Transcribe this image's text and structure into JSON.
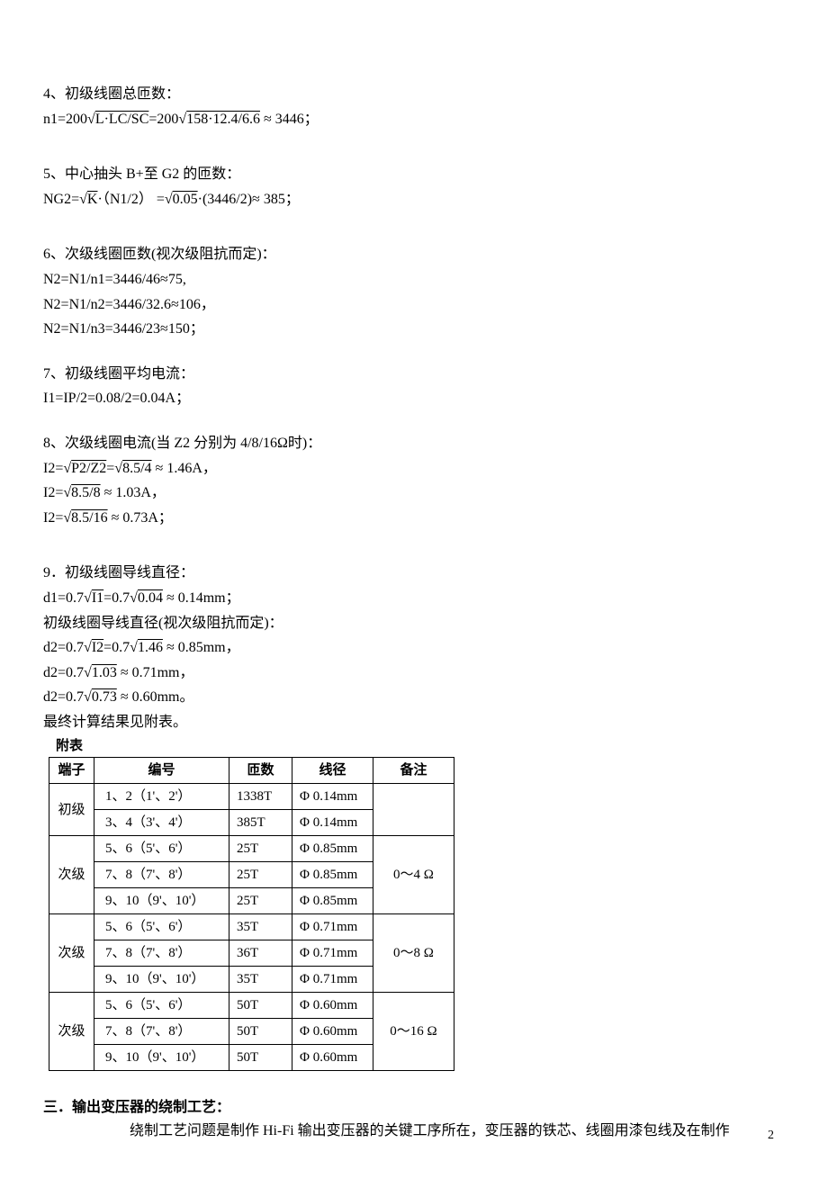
{
  "s4": {
    "heading": "4、初级线圈总匝数：",
    "formula_prefix": "n1=200√",
    "formula_sqrt1": "L·LC/SC",
    "formula_mid": "=200√",
    "formula_sqrt2": "158·12.4/6.6",
    "formula_suffix": " ≈ 3446；"
  },
  "s5": {
    "heading": "5、中心抽头 B+至 G2 的匝数：",
    "formula_prefix": "NG2=√",
    "formula_sqrt1": "K",
    "formula_mid1": "·（N1/2） =√",
    "formula_sqrt2": "0.05",
    "formula_suffix": "·(3446/2)≈ 385；"
  },
  "s6": {
    "heading": "6、次级线圈匝数(视次级阻抗而定)：",
    "line1": "N2=N1/n1=3446/46≈75,",
    "line2": "N2=N1/n2=3446/32.6≈106，",
    "line3": "N2=N1/n3=3446/23≈150；"
  },
  "s7": {
    "heading": "7、初级线圈平均电流：",
    "line1": "I1=IP/2=0.08/2=0.04A；"
  },
  "s8": {
    "heading": "8、次级线圈电流(当 Z2 分别为 4/8/16Ω时)：",
    "f1_prefix": "I2=√",
    "f1_sqrt1": "P2/Z2",
    "f1_mid": "=√",
    "f1_sqrt2": "8.5/4",
    "f1_suffix": " ≈ 1.46A，",
    "f2_prefix": "I2=√",
    "f2_sqrt": "8.5/8",
    "f2_suffix": " ≈ 1.03A，",
    "f3_prefix": "I2=√",
    "f3_sqrt": "8.5/16",
    "f3_suffix": " ≈ 0.73A；"
  },
  "s9": {
    "heading": "9．初级线圈导线直径：",
    "f1_prefix": "d1=0.7√",
    "f1_sqrt1": "I1",
    "f1_mid": "=0.7√",
    "f1_sqrt2": "0.04",
    "f1_suffix": " ≈ 0.14mm；",
    "subheading": "初级线圈导线直径(视次级阻抗而定)：",
    "f2_prefix": "d2=0.7√",
    "f2_sqrt1": "I2",
    "f2_mid": "=0.7√",
    "f2_sqrt2": "1.46",
    "f2_suffix": " ≈ 0.85mm，",
    "f3_prefix": "d2=0.7√",
    "f3_sqrt": "1.03",
    "f3_suffix": " ≈ 0.71mm，",
    "f4_prefix": "d2=0.7√",
    "f4_sqrt": "0.73",
    "f4_suffix": " ≈ 0.60mm。",
    "result_line": "最终计算结果见附表。"
  },
  "table": {
    "caption": "附表",
    "headers": [
      "端子",
      "编号",
      "匝数",
      "线径",
      "备注"
    ],
    "groups": [
      {
        "duanzi": "初级",
        "beizhu": "",
        "rows": [
          {
            "bianhao": "1、2（1'、2'）",
            "zashu": "1338T",
            "xianjing": "Φ 0.14mm"
          },
          {
            "bianhao": "3、4（3'、4'）",
            "zashu": "385T",
            "xianjing": "Φ 0.14mm"
          }
        ]
      },
      {
        "duanzi": "次级",
        "beizhu": "0～4 Ω",
        "rows": [
          {
            "bianhao": "5、6（5'、6'）",
            "zashu": "25T",
            "xianjing": "Φ 0.85mm"
          },
          {
            "bianhao": "7、8（7'、8'）",
            "zashu": "25T",
            "xianjing": "Φ 0.85mm"
          },
          {
            "bianhao": "9、10（9'、10'）",
            "zashu": "25T",
            "xianjing": "Φ 0.85mm"
          }
        ]
      },
      {
        "duanzi": "次级",
        "beizhu": "0～8 Ω",
        "rows": [
          {
            "bianhao": "5、6（5'、6'）",
            "zashu": "35T",
            "xianjing": "Φ 0.71mm"
          },
          {
            "bianhao": "7、8（7'、8'）",
            "zashu": "36T",
            "xianjing": "Φ 0.71mm"
          },
          {
            "bianhao": "9、10（9'、10'）",
            "zashu": "35T",
            "xianjing": "Φ 0.71mm"
          }
        ]
      },
      {
        "duanzi": "次级",
        "beizhu": "0～16 Ω",
        "rows": [
          {
            "bianhao": "5、6（5'、6'）",
            "zashu": "50T",
            "xianjing": "Φ 0.60mm"
          },
          {
            "bianhao": "7、8（7'、8'）",
            "zashu": "50T",
            "xianjing": "Φ 0.60mm"
          },
          {
            "bianhao": "9、10（9'、10'）",
            "zashu": "50T",
            "xianjing": "Φ 0.60mm"
          }
        ]
      }
    ]
  },
  "section3": {
    "title": "三．输出变压器的绕制工艺：",
    "body": "绕制工艺问题是制作 Hi-Fi 输出变压器的关键工序所在，变压器的铁芯、线圈用漆包线及在制作"
  },
  "page_number": "2"
}
